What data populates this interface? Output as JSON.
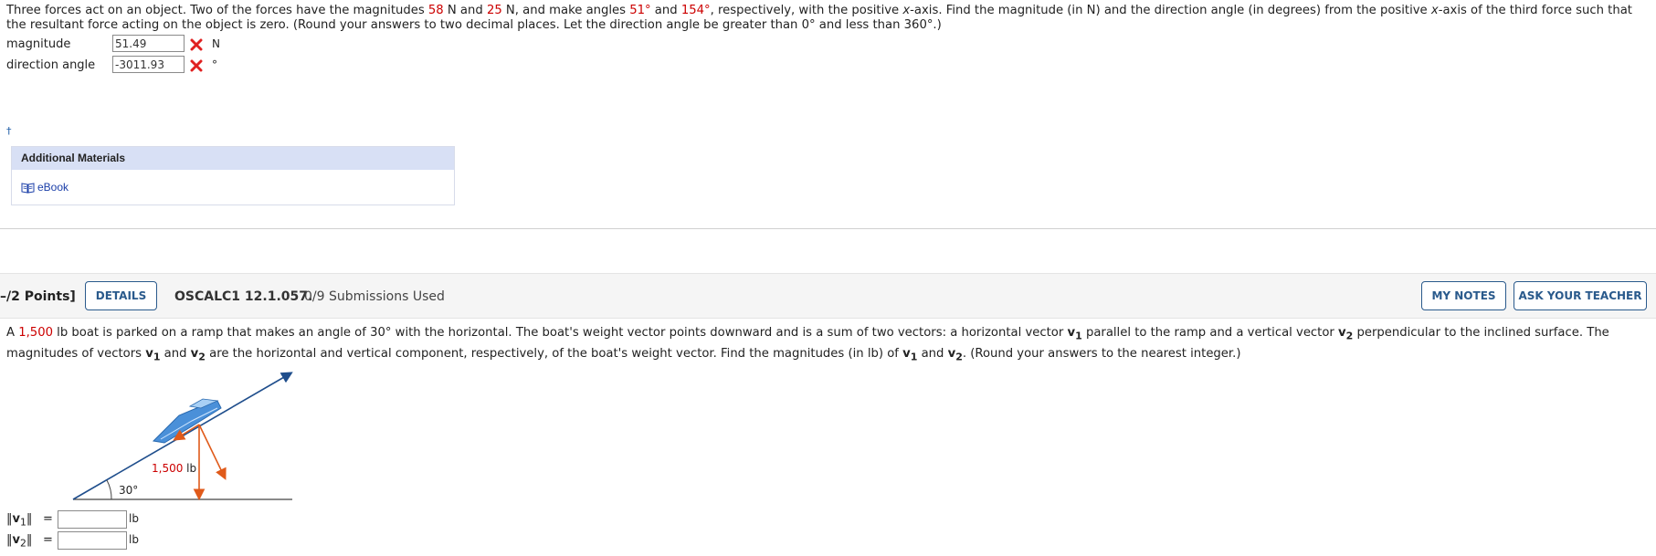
{
  "question1": {
    "text_1": "Three forces act on an object. Two of the forces have the magnitudes ",
    "force_1": "58",
    "text_2": " N and ",
    "force_2": "25",
    "text_3": " N, and make angles ",
    "angle_1": "51°",
    "text_4": " and ",
    "angle_2": "154°",
    "text_5": ", respectively, with the positive ",
    "x_var_1": "x",
    "text_6": "-axis. Find the magnitude (in N) and the direction angle (in degrees) from the positive ",
    "x_var_2": "x",
    "text_7": "-axis of the third force such that the resultant force acting on the object is zero. (Round your answers to two decimal places. Let the direction angle be greater than 0° and less than 360°.)",
    "magnitude_label": "magnitude",
    "magnitude_value": "51.49",
    "magnitude_unit": "N",
    "direction_label": "direction angle",
    "direction_value": "-3011.93",
    "direction_unit": "°"
  },
  "dagger": "†",
  "additional_materials": {
    "title": "Additional Materials",
    "ebook_label": "eBook"
  },
  "question2_header": {
    "points": "–/2 Points]",
    "details_button": "DETAILS",
    "question_code": "OSCALC1 12.1.057.",
    "submissions": "0/9 Submissions Used",
    "my_notes_button": "MY NOTES",
    "ask_teacher_button": "ASK YOUR TEACHER"
  },
  "question2": {
    "text_1": "A ",
    "weight": "1,500",
    "text_2": " lb boat is parked on a ramp that makes an angle of 30° with the horizontal. The boat's weight vector points downward and is a sum of two vectors: a horizontal vector ",
    "v1_bold": "v",
    "v1_sub": "1",
    "text_3": " parallel to the ramp and a vertical vector ",
    "v2_bold": "v",
    "v2_sub": "2",
    "text_4": " perpendicular to the inclined surface. The magnitudes of vectors ",
    "text_5": " and ",
    "text_6": " are the horizontal and vertical component, respectively, of the boat's weight vector. Find the magnitudes (in lb) of ",
    "text_7": " and ",
    "text_8": ". (Round your answers to the nearest integer.)",
    "diagram_weight_label": "1,500 lb",
    "diagram_angle_label": "30°",
    "v1_norm_open": "‖",
    "v1_letter": "v",
    "v1_index": "1",
    "v1_norm_close": "‖",
    "v2_norm_open": "‖",
    "v2_letter": "v",
    "v2_index": "2",
    "v2_norm_close": "‖",
    "equals": "=",
    "v1_value": "",
    "v2_value": "",
    "v1_unit": "lb",
    "v2_unit": "lb"
  },
  "colors": {
    "accent_red": "#cc0000",
    "button_blue": "#2a5a8c",
    "header_blue": "#d8e0f5",
    "link_blue": "#1a3ea8",
    "boat_blue": "#4a90d9",
    "arrow_orange": "#e05a1a",
    "ramp_line": "#1f4e8c"
  },
  "icons": {
    "wrong_mark": "x-mark-icon",
    "ebook": "book-icon"
  }
}
